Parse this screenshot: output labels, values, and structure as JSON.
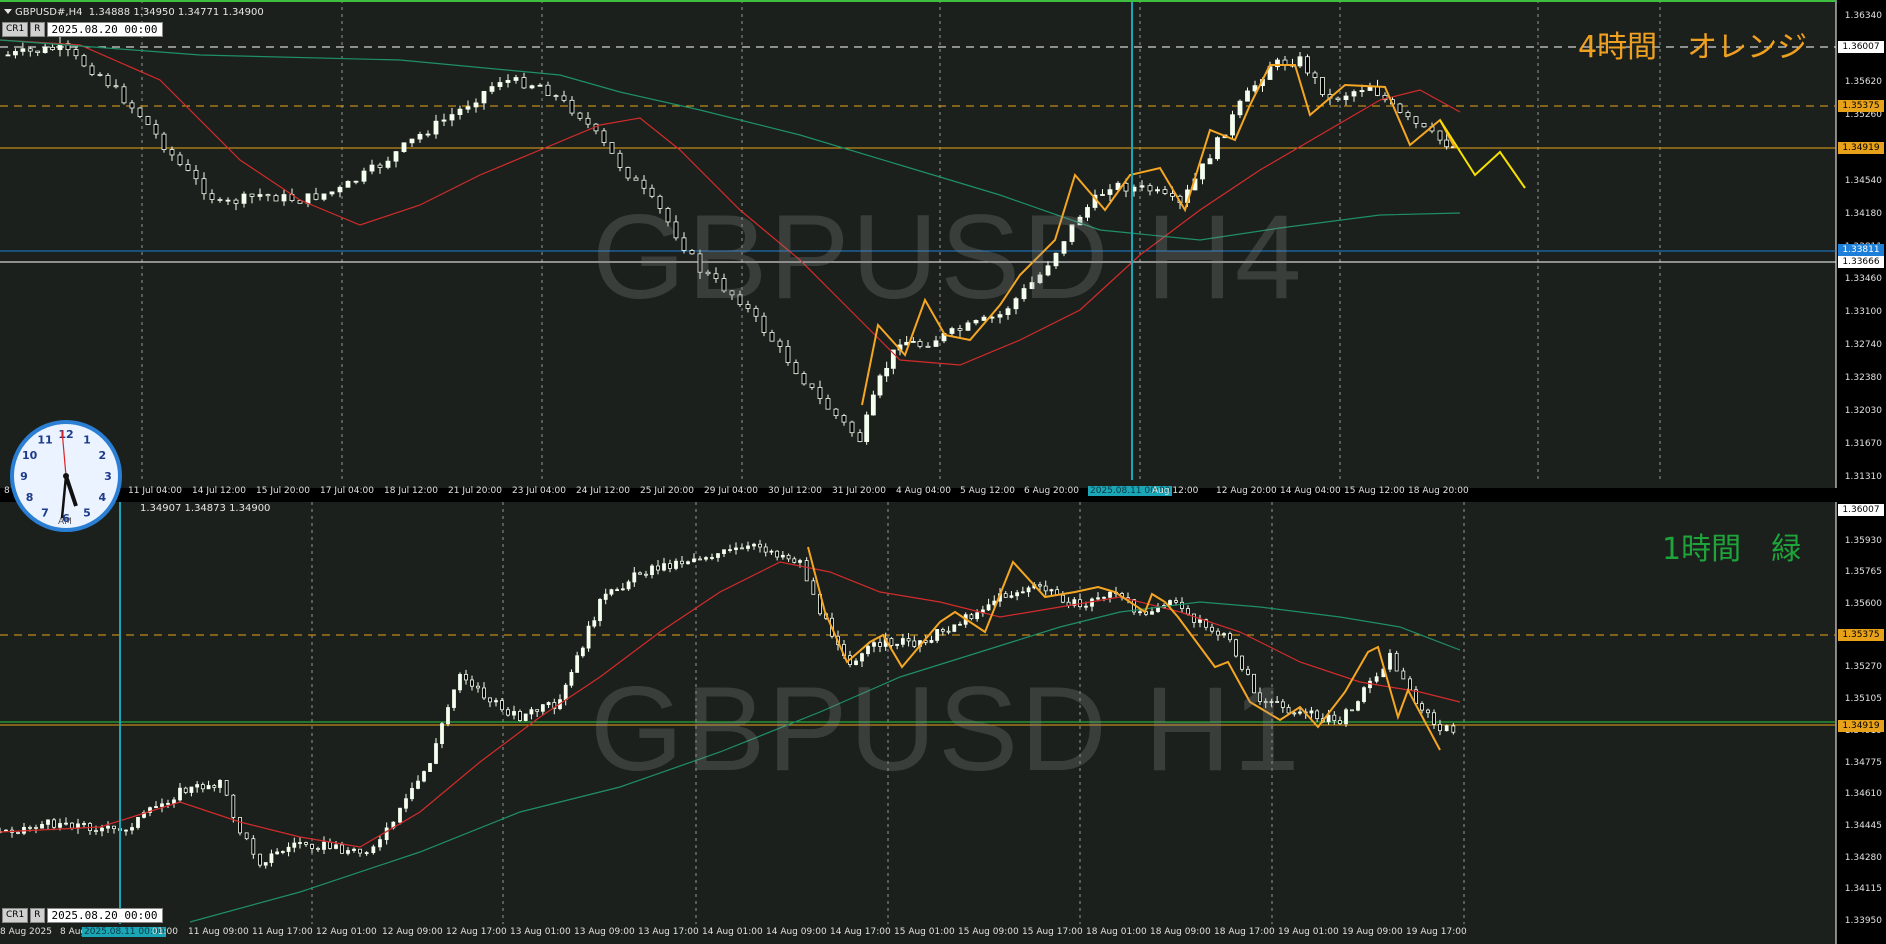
{
  "colors": {
    "bg": "#1b201c",
    "grid": "#c8c8c8",
    "bull_candle": "#f4fff0",
    "ma_red": "#d42b2b",
    "ma_green": "#1f8f6a",
    "zigzag_orange": "#f5a623",
    "zigzag_yellow": "#f6e000",
    "line_orange": "#e8a21a",
    "line_blue": "#1e7fd8",
    "line_white": "#ffffff",
    "cursor_cyan": "#1aa6b7",
    "note_orange": "#f0a020",
    "note_green": "#1ea43a"
  },
  "top": {
    "header": "GBPUSD#,H4  1.34888 1.34950 1.34771 1.34900",
    "btn_cr1": "CR1",
    "btn_r": "R",
    "date_box": "2025.08.20 00:00",
    "watermark": "GBPUSD H4",
    "note": "4時間　オレンジ",
    "y_labels": [
      "1.36340",
      "1.36007",
      "1.35620",
      "1.35260",
      "1.34919",
      "1.34540",
      "1.34180",
      "1.33811",
      "1.33460",
      "1.33100",
      "1.32740",
      "1.32380",
      "1.32030",
      "1.31670",
      "1.31310"
    ],
    "price_tags": [
      {
        "text": "1.36007",
        "bg": "#ffffff",
        "fg": "#000000"
      },
      {
        "text": "1.35375",
        "bg": "#e8a21a",
        "fg": "#000000"
      },
      {
        "text": "1.34919",
        "bg": "#e8a21a",
        "fg": "#000000"
      },
      {
        "text": "1.33811",
        "bg": "#1e7fd8",
        "fg": "#ffffff"
      },
      {
        "text": "1.33666",
        "bg": "#ffffff",
        "fg": "#000000"
      }
    ],
    "x_labels": [
      "8",
      "11 Jul 04:00",
      "14 Jul 12:00",
      "15 Jul 20:00",
      "17 Jul 04:00",
      "18 Jul 12:00",
      "21 Jul 20:00",
      "23 Jul 04:00",
      "24 Jul 12:00",
      "25 Jul 20:00",
      "29 Jul 04:00",
      "30 Jul 12:00",
      "31 Jul 20:00",
      "4 Aug 04:00",
      "5 Aug 12:00",
      "6 Aug 20:00",
      "2025.08.11 00:00",
      "Aug 12:00",
      "12 Aug 20:00",
      "14 Aug 04:00",
      "15 Aug 12:00",
      "18 Aug 20:00"
    ]
  },
  "bottom": {
    "header": "1.34907 1.34873 1.34900",
    "btn_cr1": "CR1",
    "btn_r": "R",
    "date_box": "2025.08.20 00:00",
    "watermark": "GBPUSD H1",
    "note": "1時間　緑",
    "y_labels": [
      "1.36007",
      "1.35930",
      "1.35765",
      "1.35600",
      "1.35435",
      "1.35270",
      "1.35105",
      "1.34919",
      "1.34775",
      "1.34610",
      "1.34445",
      "1.34280",
      "1.34115",
      "1.33950"
    ],
    "price_tags": [
      {
        "text": "1.36007",
        "bg": "#ffffff",
        "fg": "#000000"
      },
      {
        "text": "1.35375",
        "bg": "#e8a21a",
        "fg": "#000000"
      },
      {
        "text": "1.34919",
        "bg": "#e8a21a",
        "fg": "#000000"
      }
    ],
    "x_labels": [
      "8 Aug 2025",
      "8 Aug",
      "2025.08.11 00:00",
      "01:00",
      "11 Aug 09:00",
      "11 Aug 17:00",
      "12 Aug 01:00",
      "12 Aug 09:00",
      "12 Aug 17:00",
      "13 Aug 01:00",
      "13 Aug 09:00",
      "13 Aug 17:00",
      "14 Aug 01:00",
      "14 Aug 09:00",
      "14 Aug 17:00",
      "15 Aug 01:00",
      "15 Aug 09:00",
      "15 Aug 17:00",
      "18 Aug 01:00",
      "18 Aug 09:00",
      "18 Aug 17:00",
      "19 Aug 01:00",
      "19 Aug 09:00",
      "19 Aug 17:00"
    ]
  },
  "clock": {
    "numbers": [
      "12",
      "1",
      "2",
      "3",
      "4",
      "5",
      "6",
      "7",
      "8",
      "9",
      "10",
      "11"
    ],
    "label": "AM"
  }
}
